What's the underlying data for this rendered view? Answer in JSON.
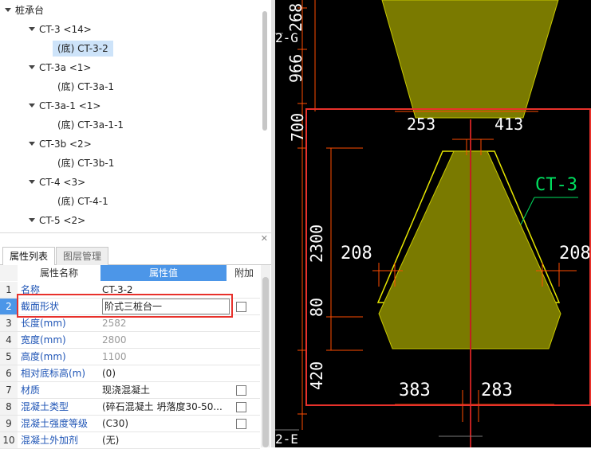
{
  "tree": {
    "root": "桩承台",
    "items": [
      {
        "label": "CT-3 <14>",
        "level": 1,
        "expanded": true
      },
      {
        "label": "(底) CT-3-2",
        "level": 2,
        "selected": true
      },
      {
        "label": "CT-3a <1>",
        "level": 1,
        "expanded": true
      },
      {
        "label": "(底) CT-3a-1",
        "level": 2
      },
      {
        "label": "CT-3a-1 <1>",
        "level": 1,
        "expanded": true
      },
      {
        "label": "(底) CT-3a-1-1",
        "level": 2
      },
      {
        "label": "CT-3b <2>",
        "level": 1,
        "expanded": true
      },
      {
        "label": "(底) CT-3b-1",
        "level": 2
      },
      {
        "label": "CT-4 <3>",
        "level": 1,
        "expanded": true
      },
      {
        "label": "(底) CT-4-1",
        "level": 2
      },
      {
        "label": "CT-5 <2>",
        "level": 1,
        "expanded": true
      }
    ]
  },
  "tabs": {
    "properties": "属性列表",
    "layers": "图层管理"
  },
  "grid": {
    "header_name": "属性名称",
    "header_value": "属性值",
    "header_extra": "附加",
    "rows": [
      {
        "no": "1",
        "name": "名称",
        "value": "CT-3-2",
        "check": false,
        "gray": false
      },
      {
        "no": "2",
        "name": "截面形状",
        "value": "阶式三桩台一",
        "check": true,
        "gray": false,
        "active": true
      },
      {
        "no": "3",
        "name": "长度(mm)",
        "value": "2582",
        "check": false,
        "gray": true
      },
      {
        "no": "4",
        "name": "宽度(mm)",
        "value": "2800",
        "check": false,
        "gray": true
      },
      {
        "no": "5",
        "name": "高度(mm)",
        "value": "1100",
        "check": false,
        "gray": true
      },
      {
        "no": "6",
        "name": "相对底标高(m)",
        "value": "(0)",
        "check": false,
        "gray": false
      },
      {
        "no": "7",
        "name": "材质",
        "value": "现浇混凝土",
        "check": true,
        "gray": false
      },
      {
        "no": "8",
        "name": "混凝土类型",
        "value": "(碎石混凝土 坍落度30-50...",
        "check": true,
        "gray": false
      },
      {
        "no": "9",
        "name": "混凝土强度等级",
        "value": "(C30)",
        "check": true,
        "gray": false
      },
      {
        "no": "10",
        "name": "混凝土外加剂",
        "value": "(无)",
        "check": false,
        "gray": false
      }
    ]
  },
  "cad": {
    "dims": {
      "top_v1": "268",
      "top_v2": "966",
      "v_700": "700",
      "v_2300": "2300",
      "v_80": "80",
      "v_420": "420",
      "h_253": "253",
      "h_413": "413",
      "h_208_left": "208",
      "h_208_right": "208",
      "h_383": "383",
      "h_283": "283"
    },
    "axis_top": "2-G",
    "axis_bottom": "2-E",
    "tag": "CT-3",
    "colors": {
      "fill": "#7a7a00",
      "outline": "#e6e600",
      "dim": "#ff4d00",
      "tag": "#00e060",
      "highlight": "#e8312b"
    }
  }
}
